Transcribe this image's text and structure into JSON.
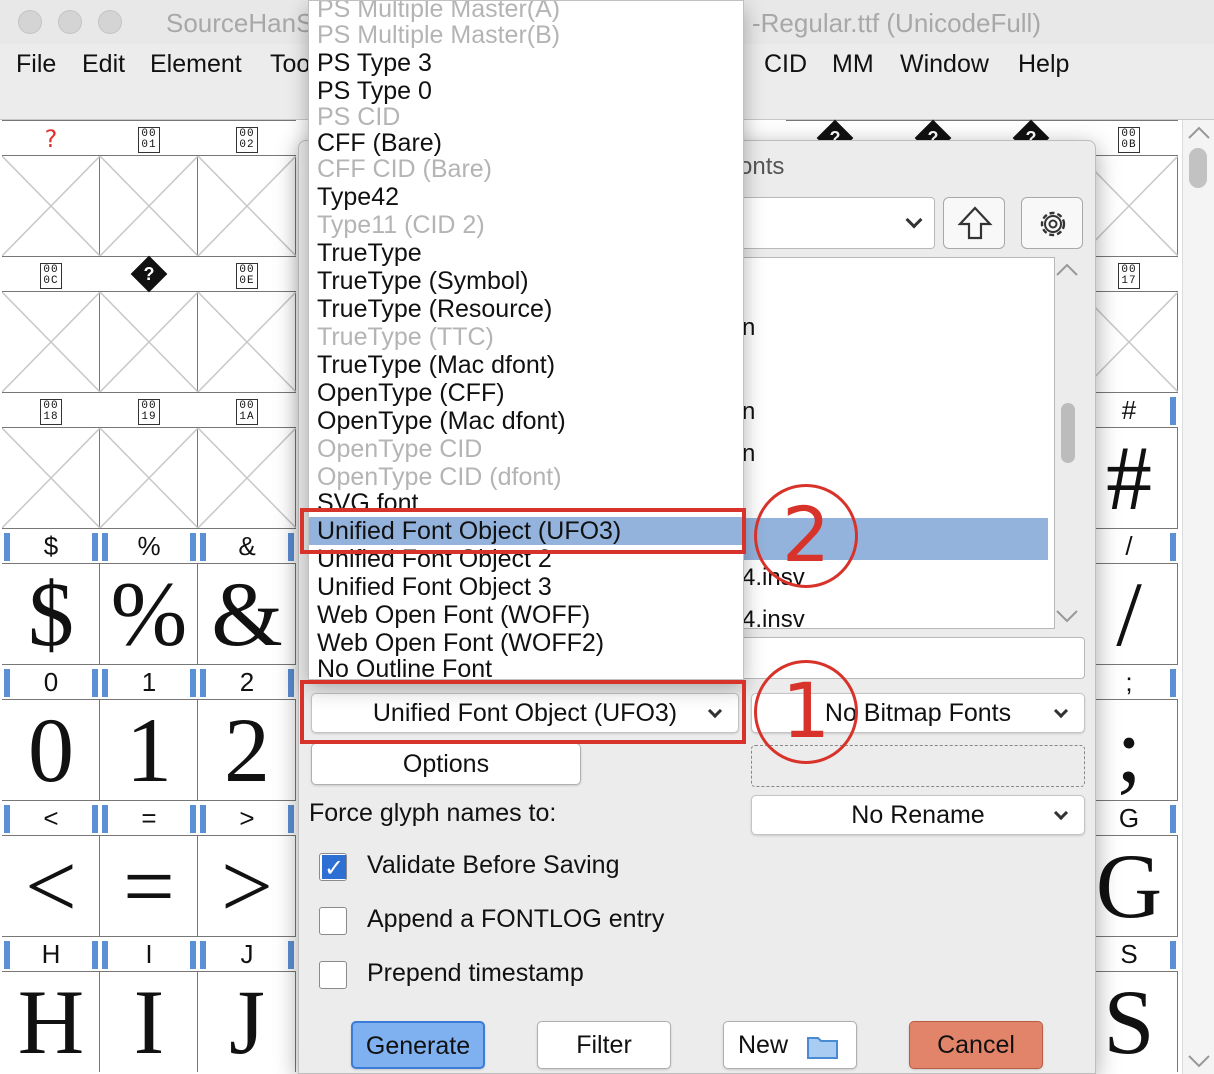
{
  "window": {
    "title_left": "SourceHanS",
    "title_right": "-Regular.ttf (UnicodeFull)"
  },
  "menubar": {
    "items": [
      {
        "label": "File",
        "u": "F"
      },
      {
        "label": "Edit",
        "u": "E"
      },
      {
        "label": "Element",
        "u": "E"
      },
      {
        "label": "Too",
        "u": "T"
      },
      {
        "label": "CID",
        "u": "C"
      },
      {
        "label": "MM",
        "u": ""
      },
      {
        "label": "Window",
        "u": "W"
      },
      {
        "label": "Help",
        "u": "H"
      }
    ]
  },
  "grid": {
    "columns": [
      {
        "rows": [
          {
            "label": "?",
            "kind": "qred"
          },
          {
            "label": "00\n0C",
            "kind": "hex"
          },
          {
            "label": "00\n18",
            "kind": "hex"
          },
          {
            "label": "$",
            "glyph": "$"
          },
          {
            "label": "0",
            "glyph": "0"
          },
          {
            "label": "<",
            "glyph": "<"
          },
          {
            "label": "H",
            "glyph": "H"
          }
        ]
      },
      {
        "rows": [
          {
            "label": "00\n01",
            "kind": "hex"
          },
          {
            "label": "?",
            "kind": "diamond"
          },
          {
            "label": "00\n19",
            "kind": "hex"
          },
          {
            "label": "%",
            "glyph": "%"
          },
          {
            "label": "1",
            "glyph": "1"
          },
          {
            "label": "=",
            "glyph": "="
          },
          {
            "label": "I",
            "glyph": "I"
          }
        ]
      },
      {
        "rows": [
          {
            "label": "00\n02",
            "kind": "hex"
          },
          {
            "label": "00\n0E",
            "kind": "hex"
          },
          {
            "label": "00\n1A",
            "kind": "hex"
          },
          {
            "label": "&",
            "glyph": "&"
          },
          {
            "label": "2",
            "glyph": "2"
          },
          {
            "label": ">",
            "glyph": ">"
          },
          {
            "label": "J",
            "glyph": "J"
          }
        ]
      }
    ],
    "right_columns": [
      {
        "rows": [
          {
            "label": "?",
            "kind": "diamond"
          }
        ]
      },
      {
        "rows": [
          {
            "label": "?",
            "kind": "diamond"
          }
        ]
      },
      {
        "rows": [
          {
            "label": "?",
            "kind": "diamond"
          }
        ]
      },
      {
        "rows": [
          {
            "label": "00\n0B",
            "kind": "hex"
          },
          {
            "label": "00\n17",
            "kind": "hex"
          },
          {
            "label": "#",
            "glyph": "#"
          },
          {
            "label": "/",
            "glyph": "/"
          },
          {
            "label": ";",
            "glyph": ";"
          },
          {
            "label": "G",
            "glyph": "G"
          },
          {
            "label": "S",
            "glyph": "S"
          }
        ]
      }
    ]
  },
  "dialog": {
    "title_fragment": "onts",
    "file_items": [
      "n",
      "n",
      "n",
      "4.insv",
      "4.insv"
    ],
    "outline_format": "Unified Font Object (UFO3)",
    "bitmap_format": "No Bitmap Fonts",
    "options_label": "Options",
    "force_glyph_label": "Force glyph names to:",
    "rename_option": "No Rename",
    "checks": [
      {
        "label": "Validate Before Saving",
        "checked": true
      },
      {
        "label": "Append a FONTLOG entry",
        "checked": false
      },
      {
        "label": "Prepend timestamp",
        "checked": false
      }
    ],
    "buttons": {
      "generate": "Generate",
      "filter": "Filter",
      "new": "New",
      "cancel": "Cancel"
    }
  },
  "format_list": {
    "items": [
      {
        "label": "PS Multiple Master(A)",
        "enabled": false
      },
      {
        "label": "PS Multiple Master(B)",
        "enabled": false
      },
      {
        "label": "PS Type 3",
        "enabled": true
      },
      {
        "label": "PS Type 0",
        "enabled": true
      },
      {
        "label": "PS CID",
        "enabled": false
      },
      {
        "label": "CFF (Bare)",
        "enabled": true
      },
      {
        "label": "CFF CID (Bare)",
        "enabled": false
      },
      {
        "label": "Type42",
        "enabled": true
      },
      {
        "label": "Type11 (CID 2)",
        "enabled": false
      },
      {
        "label": "TrueType",
        "enabled": true
      },
      {
        "label": "TrueType (Symbol)",
        "enabled": true
      },
      {
        "label": "TrueType (Resource)",
        "enabled": true
      },
      {
        "label": "TrueType (TTC)",
        "enabled": false
      },
      {
        "label": "TrueType (Mac dfont)",
        "enabled": true
      },
      {
        "label": "OpenType (CFF)",
        "enabled": true
      },
      {
        "label": "OpenType (Mac dfont)",
        "enabled": true
      },
      {
        "label": "OpenType CID",
        "enabled": false
      },
      {
        "label": "OpenType CID (dfont)",
        "enabled": false
      },
      {
        "label": "SVG font",
        "enabled": true
      },
      {
        "label": "Unified Font Object (UFO3)",
        "enabled": true,
        "selected": true
      },
      {
        "label": "Unified Font Object 2",
        "enabled": true
      },
      {
        "label": "Unified Font Object 3",
        "enabled": true
      },
      {
        "label": "Web Open Font (WOFF)",
        "enabled": true
      },
      {
        "label": "Web Open Font (WOFF2)",
        "enabled": true
      },
      {
        "label": "No Outline Font",
        "enabled": true
      }
    ]
  },
  "annotations": {
    "circle_1": "1",
    "circle_2": "2",
    "accent": "#d8332a"
  }
}
